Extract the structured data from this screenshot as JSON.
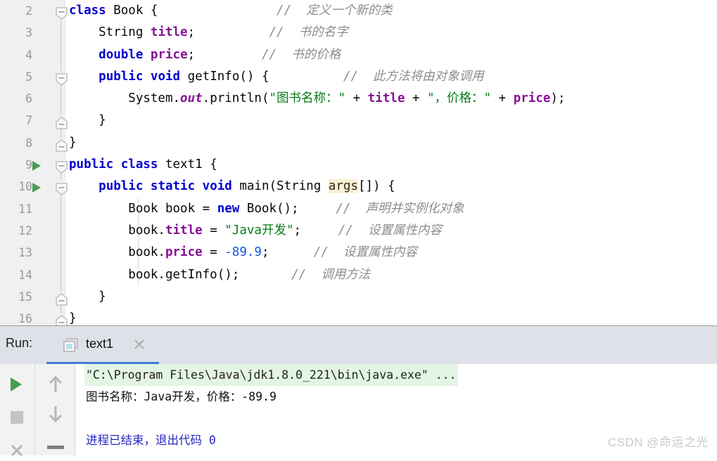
{
  "editor": {
    "lines": [
      {
        "number": "2",
        "runnable": false,
        "fold": "open-top",
        "indent_guides": [],
        "tokens": [
          {
            "t": "class",
            "c": "kw"
          },
          {
            "t": " ",
            "c": "plain"
          },
          {
            "t": "Book",
            "c": "plain"
          },
          {
            "t": " {",
            "c": "plain"
          },
          {
            "t": "                ",
            "c": "plain"
          },
          {
            "t": "//  定义一个新的类",
            "c": "cmt"
          }
        ]
      },
      {
        "number": "3",
        "runnable": false,
        "fold": "line",
        "indent_guides": [],
        "tokens": [
          {
            "t": "    String ",
            "c": "plain"
          },
          {
            "t": "title",
            "c": "fld"
          },
          {
            "t": ";",
            "c": "plain"
          },
          {
            "t": "          ",
            "c": "plain"
          },
          {
            "t": "//  书的名字",
            "c": "cmt"
          }
        ]
      },
      {
        "number": "4",
        "runnable": false,
        "fold": "line",
        "indent_guides": [],
        "tokens": [
          {
            "t": "    ",
            "c": "plain"
          },
          {
            "t": "double",
            "c": "kw"
          },
          {
            "t": " ",
            "c": "plain"
          },
          {
            "t": "price",
            "c": "fld"
          },
          {
            "t": ";",
            "c": "plain"
          },
          {
            "t": "         ",
            "c": "plain"
          },
          {
            "t": "//  书的价格",
            "c": "cmt"
          }
        ]
      },
      {
        "number": "5",
        "runnable": false,
        "fold": "open-mid",
        "indent_guides": [],
        "tokens": [
          {
            "t": "    ",
            "c": "plain"
          },
          {
            "t": "public void",
            "c": "kw"
          },
          {
            "t": " getInfo() {",
            "c": "plain"
          },
          {
            "t": "          ",
            "c": "plain"
          },
          {
            "t": "//  此方法将由对象调用",
            "c": "cmt"
          }
        ]
      },
      {
        "number": "6",
        "runnable": false,
        "fold": "line",
        "indent_guides": [
          198
        ],
        "tokens": [
          {
            "t": "        System.",
            "c": "plain"
          },
          {
            "t": "out",
            "c": "stat"
          },
          {
            "t": ".println(",
            "c": "plain"
          },
          {
            "t": "\"图书名称：\"",
            "c": "str"
          },
          {
            "t": " + ",
            "c": "plain"
          },
          {
            "t": "title",
            "c": "fld"
          },
          {
            "t": " + ",
            "c": "plain"
          },
          {
            "t": "\"，价格：\"",
            "c": "str"
          },
          {
            "t": " + ",
            "c": "plain"
          },
          {
            "t": "price",
            "c": "fld"
          },
          {
            "t": ");",
            "c": "plain"
          }
        ]
      },
      {
        "number": "7",
        "runnable": false,
        "fold": "close-mid",
        "indent_guides": [],
        "tokens": [
          {
            "t": "    }",
            "c": "plain"
          }
        ]
      },
      {
        "number": "8",
        "runnable": false,
        "fold": "close-top",
        "indent_guides": [],
        "tokens": [
          {
            "t": "}",
            "c": "plain"
          }
        ]
      },
      {
        "number": "9",
        "runnable": true,
        "fold": "open-top",
        "indent_guides": [],
        "tokens": [
          {
            "t": "public class",
            "c": "kw"
          },
          {
            "t": " text1 {",
            "c": "plain"
          }
        ]
      },
      {
        "number": "10",
        "runnable": true,
        "fold": "open-mid",
        "indent_guides": [],
        "tokens": [
          {
            "t": "    ",
            "c": "plain"
          },
          {
            "t": "public static void",
            "c": "kw"
          },
          {
            "t": " main(String ",
            "c": "plain"
          },
          {
            "t": "args",
            "c": "hl"
          },
          {
            "t": "[]) {",
            "c": "plain"
          }
        ]
      },
      {
        "number": "11",
        "runnable": false,
        "fold": "line",
        "indent_guides": [
          196
        ],
        "tokens": [
          {
            "t": "        Book book = ",
            "c": "plain"
          },
          {
            "t": "new",
            "c": "kw"
          },
          {
            "t": " Book();",
            "c": "plain"
          },
          {
            "t": "     ",
            "c": "plain"
          },
          {
            "t": "//  声明并实例化对象",
            "c": "cmt"
          }
        ]
      },
      {
        "number": "12",
        "runnable": false,
        "fold": "line",
        "indent_guides": [
          196
        ],
        "tokens": [
          {
            "t": "        book.",
            "c": "plain"
          },
          {
            "t": "title",
            "c": "fld"
          },
          {
            "t": " = ",
            "c": "plain"
          },
          {
            "t": "\"Java开发\"",
            "c": "str"
          },
          {
            "t": ";",
            "c": "plain"
          },
          {
            "t": "     ",
            "c": "plain"
          },
          {
            "t": "//  设置属性内容",
            "c": "cmt"
          }
        ]
      },
      {
        "number": "13",
        "runnable": false,
        "fold": "line",
        "indent_guides": [
          196
        ],
        "tokens": [
          {
            "t": "        book.",
            "c": "plain"
          },
          {
            "t": "price",
            "c": "fld"
          },
          {
            "t": " = ",
            "c": "plain"
          },
          {
            "t": "-89.9",
            "c": "num"
          },
          {
            "t": ";",
            "c": "plain"
          },
          {
            "t": "      ",
            "c": "plain"
          },
          {
            "t": "//  设置属性内容",
            "c": "cmt"
          }
        ]
      },
      {
        "number": "14",
        "runnable": false,
        "fold": "line",
        "indent_guides": [
          196
        ],
        "tokens": [
          {
            "t": "        book.getInfo();",
            "c": "plain"
          },
          {
            "t": "       ",
            "c": "plain"
          },
          {
            "t": "//  调用方法",
            "c": "cmt"
          }
        ]
      },
      {
        "number": "15",
        "runnable": false,
        "fold": "close-mid",
        "indent_guides": [],
        "tokens": [
          {
            "t": "    }",
            "c": "plain"
          }
        ]
      },
      {
        "number": "16",
        "runnable": false,
        "fold": "close-top",
        "indent_guides": [],
        "tokens": [
          {
            "t": "}",
            "c": "plain"
          }
        ]
      }
    ]
  },
  "run_panel": {
    "label": "Run:",
    "tab_label": "text1",
    "tab_icon": "window-icon",
    "close_icon": "close-icon",
    "toolbar": [
      {
        "name": "rerun-button",
        "icon": "play-icon"
      },
      {
        "name": "stop-button",
        "icon": "stop-icon"
      },
      {
        "name": "close-run-button",
        "icon": "x-icon"
      },
      {
        "name": "scroll-up-button",
        "icon": "arrow-up-icon"
      },
      {
        "name": "scroll-down-button",
        "icon": "arrow-down-icon"
      },
      {
        "name": "soft-wrap-button",
        "icon": "minus-icon"
      }
    ],
    "console_lines": [
      {
        "text": "\"C:\\Program Files\\Java\\jdk1.8.0_221\\bin\\java.exe\" ...",
        "style": "c-cmdline"
      },
      {
        "text": "图书名称：Java开发，价格：-89.9",
        "style": "c-out"
      },
      {
        "text": "",
        "style": "c-out"
      },
      {
        "text": "进程已结束，退出代码 0",
        "style": "c-exit"
      }
    ]
  },
  "watermark": "CSDN @命运之光",
  "colors": {
    "keyword": "#0000d0",
    "field": "#871094",
    "string": "#067d17",
    "number": "#1750eb",
    "comment": "#8c8c8c",
    "run_green": "#499c54",
    "tab_underline": "#3b7dd8",
    "console_highlight": "#e3f5e3",
    "args_highlight": "#fbf1cf"
  }
}
